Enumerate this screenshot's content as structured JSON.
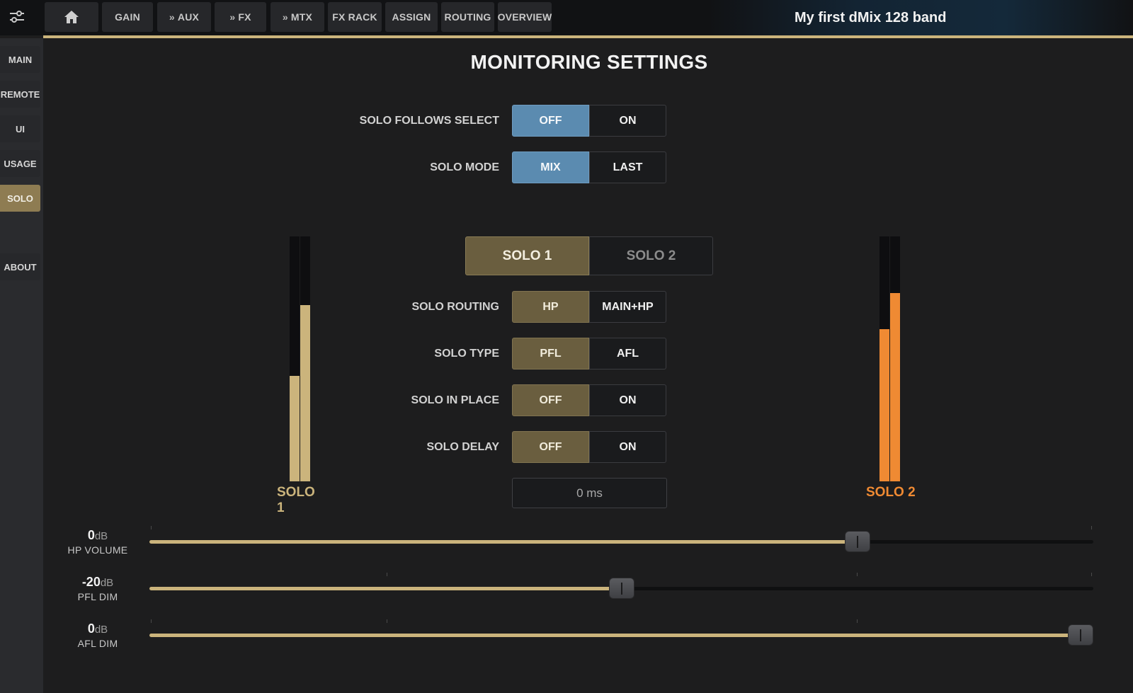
{
  "top_bar": {
    "tabs": [
      {
        "label": "GAIN",
        "chevron": false
      },
      {
        "label": "AUX",
        "chevron": true
      },
      {
        "label": "FX",
        "chevron": true
      },
      {
        "label": "MTX",
        "chevron": true
      },
      {
        "label": "FX RACK",
        "chevron": false
      },
      {
        "label": "ASSIGN",
        "chevron": false
      },
      {
        "label": "ROUTING",
        "chevron": false
      },
      {
        "label": "OVERVIEW",
        "chevron": false
      }
    ],
    "band_name": "My first dMix 128 band",
    "icons": {
      "menu": "sliders-icon",
      "home": "home-icon",
      "chevron": "double-chevron-right-icon"
    }
  },
  "sidebar": {
    "items": [
      {
        "label": "MAIN",
        "active": false
      },
      {
        "label": "REMOTE",
        "active": false
      },
      {
        "label": "UI",
        "active": false
      },
      {
        "label": "USAGE",
        "active": false
      },
      {
        "label": "SOLO",
        "active": true
      },
      {
        "label": "ABOUT",
        "active": false
      }
    ]
  },
  "page": {
    "title": "MONITORING SETTINGS"
  },
  "settings": {
    "solo_follows_select": {
      "label": "SOLO FOLLOWS SELECT",
      "options": [
        "OFF",
        "ON"
      ],
      "selected": "OFF"
    },
    "solo_mode": {
      "label": "SOLO MODE",
      "options": [
        "MIX",
        "LAST"
      ],
      "selected": "MIX"
    },
    "solo_bus_tabs": {
      "options": [
        "SOLO 1",
        "SOLO 2"
      ],
      "selected": "SOLO 1"
    },
    "solo_routing": {
      "label": "SOLO ROUTING",
      "options": [
        "HP",
        "MAIN+HP"
      ],
      "selected": "HP"
    },
    "solo_type": {
      "label": "SOLO TYPE",
      "options": [
        "PFL",
        "AFL"
      ],
      "selected": "PFL"
    },
    "solo_in_place": {
      "label": "SOLO IN PLACE",
      "options": [
        "OFF",
        "ON"
      ],
      "selected": "OFF"
    },
    "solo_delay": {
      "label": "SOLO DELAY",
      "options": [
        "OFF",
        "ON"
      ],
      "selected": "OFF",
      "value": "0 ms"
    }
  },
  "meters": {
    "solo1": {
      "label": "SOLO 1",
      "color": "#cbb47c",
      "levels": [
        0.43,
        0.72
      ]
    },
    "solo2": {
      "label": "SOLO 2",
      "color": "#ef8a33",
      "levels": [
        0.62,
        0.77
      ]
    }
  },
  "sliders": [
    {
      "key": "hp_volume",
      "value": "0",
      "unit": "dB",
      "name": "HP VOLUME",
      "fraction": 0.75
    },
    {
      "key": "pfl_dim",
      "value": "-20",
      "unit": "dB",
      "name": "PFL DIM",
      "fraction": 0.5
    },
    {
      "key": "afl_dim",
      "value": "0",
      "unit": "dB",
      "name": "AFL DIM",
      "fraction": 1.0
    }
  ],
  "colors": {
    "accent_gold": "#cbb47c",
    "selected_blue": "#5b8bb0",
    "selected_gold": "#6a5e3f",
    "solo2_orange": "#ef8a33"
  }
}
